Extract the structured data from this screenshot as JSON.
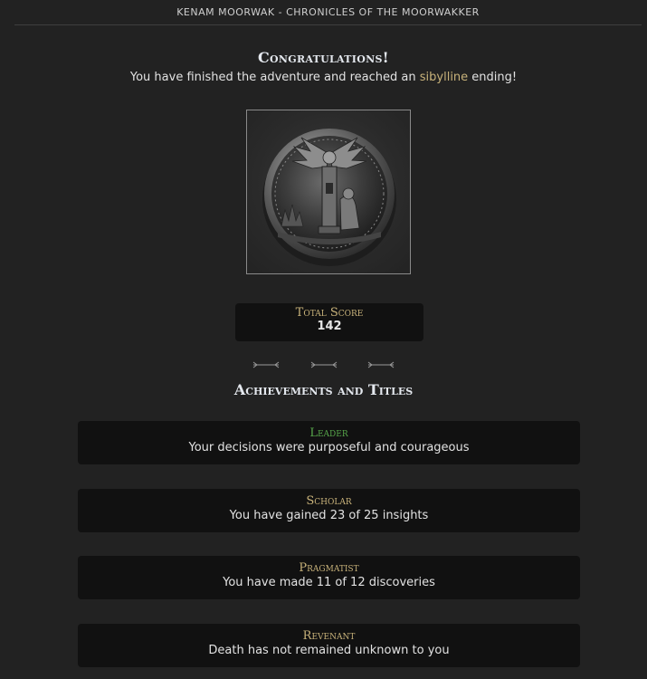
{
  "header": {
    "title": "KENAM MOORWAK - CHRONICLES OF THE MOORWAKKER"
  },
  "ending": {
    "heading": "Congratulations!",
    "text_before": "You have finished the adventure and reached an ",
    "ending_type": "sibylline",
    "text_after": " ending!"
  },
  "medal": {
    "icon": "medal-seal-icon"
  },
  "score": {
    "label": "Total Score",
    "value": "142"
  },
  "achievements": {
    "title": "Achievements and Titles",
    "items": [
      {
        "name": "Leader",
        "description": "Your decisions were purposeful and courageous",
        "color": "#57a64a"
      },
      {
        "name": "Scholar",
        "description": "You have gained 23 of 25 insights",
        "color": "#c8b27a"
      },
      {
        "name": "Pragmatist",
        "description": "You have made 11 of 12 discoveries",
        "color": "#c8b27a"
      },
      {
        "name": "Revenant",
        "description": "Death has not remained unknown to you",
        "color": "#c8b27a"
      }
    ]
  },
  "colors": {
    "background": "#222222",
    "card": "#111111",
    "accent_gold": "#c8b27a",
    "accent_green": "#57a64a"
  }
}
